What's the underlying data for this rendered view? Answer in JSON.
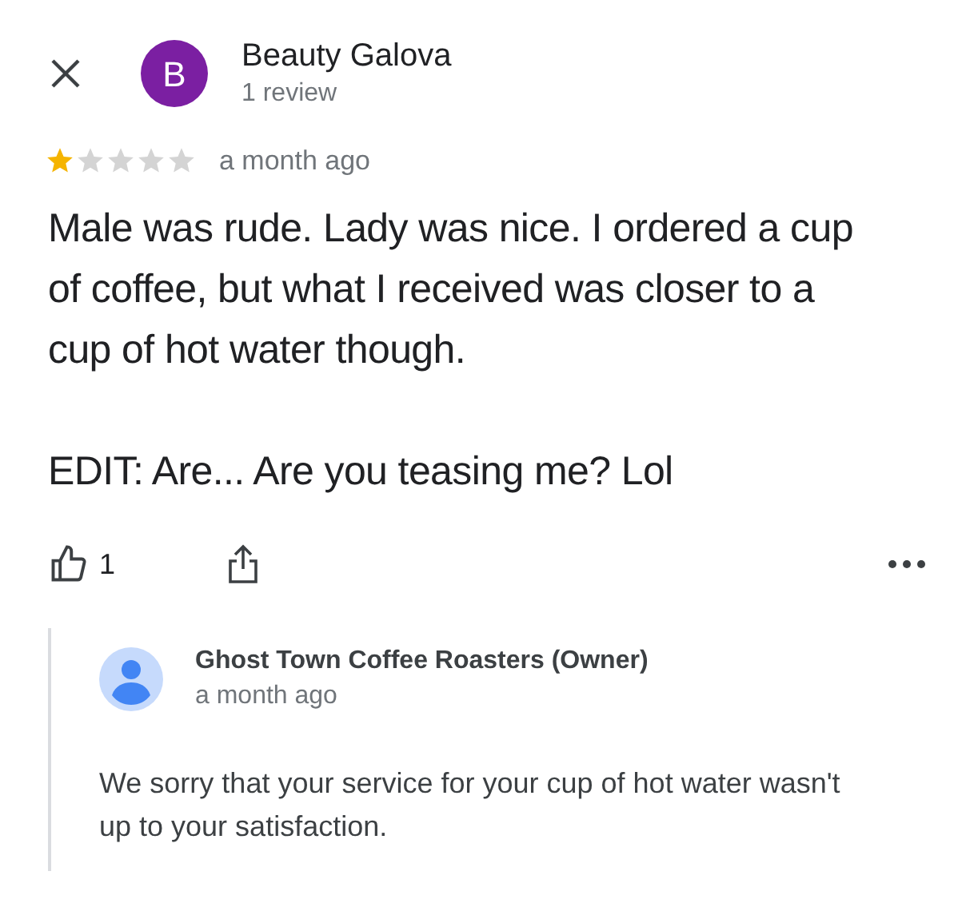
{
  "reviewer": {
    "initial": "B",
    "name": "Beauty Galova",
    "meta": "1 review"
  },
  "rating": {
    "stars": 1,
    "time": "a month ago"
  },
  "review": {
    "paragraphs": [
      "Male was rude. Lady was nice. I ordered a cup of coffee, but what I received was closer to a cup of hot water though.",
      "EDIT: Are... Are you teasing me? Lol"
    ]
  },
  "actions": {
    "likes": "1"
  },
  "reply": {
    "name": "Ghost Town Coffee Roasters (Owner)",
    "time": "a month ago",
    "text": "We sorry that your service for your cup of hot water wasn't up to your satisfaction."
  }
}
